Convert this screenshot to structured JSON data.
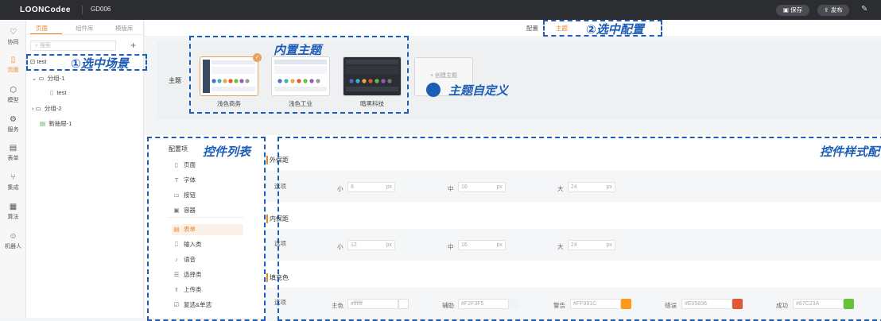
{
  "topbar": {
    "logo": "LOONCodee",
    "project": "GD006",
    "save_label": "保存",
    "publish_label": "发布",
    "save_icon": "save-icon",
    "publish_icon": "upload-icon"
  },
  "leftnav": {
    "items": [
      {
        "label": "协同",
        "glyph": "♡"
      },
      {
        "label": "页面",
        "glyph": "▯"
      },
      {
        "label": "模型",
        "glyph": "⬡"
      },
      {
        "label": "服务",
        "glyph": "⚙"
      },
      {
        "label": "表单",
        "glyph": "▤"
      },
      {
        "label": "集成",
        "glyph": "⑂"
      },
      {
        "label": "算法",
        "glyph": "▦"
      },
      {
        "label": "机器人",
        "glyph": "☺"
      }
    ]
  },
  "pagepane": {
    "tabs": [
      "页面",
      "组件库",
      "模版库"
    ],
    "search_placeholder": "搜索",
    "tree": [
      {
        "label": "test",
        "icon": "bookmark-icon"
      },
      {
        "label": "分组-1",
        "icon": "folder-icon"
      },
      {
        "label": "test",
        "icon": "page-icon"
      },
      {
        "label": "分组-2",
        "icon": "folder-icon"
      },
      {
        "label": "新抽屉-1",
        "icon": "drawer-icon"
      }
    ]
  },
  "config": {
    "tabs": [
      "配置",
      "主题"
    ],
    "active_tab": "主题"
  },
  "theme": {
    "label": "主题",
    "cards": [
      {
        "name": "浅色商务",
        "selected": true,
        "dark": false
      },
      {
        "name": "浅色工业",
        "selected": false,
        "dark": false
      },
      {
        "name": "暗黑科技",
        "selected": false,
        "dark": true
      }
    ],
    "create_label": "+ 创建主题"
  },
  "controls": {
    "header": "配置项",
    "items": [
      {
        "label": "页面",
        "glyph": "▯"
      },
      {
        "label": "字体",
        "glyph": "T"
      },
      {
        "label": "按钮",
        "glyph": "▭"
      },
      {
        "label": "容器",
        "glyph": "▣"
      },
      {
        "label": "表单",
        "glyph": "▤",
        "active": true
      },
      {
        "label": "输入类",
        "glyph": "⎕"
      },
      {
        "label": "语音",
        "glyph": "♪"
      },
      {
        "label": "选择类",
        "glyph": "☰"
      },
      {
        "label": "上传类",
        "glyph": "⇪"
      },
      {
        "label": "复选&单选",
        "glyph": "☑"
      }
    ]
  },
  "styles": {
    "sections": [
      {
        "title": "外保距",
        "row_label": "选项",
        "fields": [
          {
            "label": "小",
            "value": "8",
            "unit": "px"
          },
          {
            "label": "中",
            "value": "16",
            "unit": "px"
          },
          {
            "label": "大",
            "value": "24",
            "unit": "px"
          }
        ]
      },
      {
        "title": "内保距",
        "row_label": "选项",
        "fields": [
          {
            "label": "小",
            "value": "12",
            "unit": "px"
          },
          {
            "label": "中",
            "value": "16",
            "unit": "px"
          },
          {
            "label": "大",
            "value": "24",
            "unit": "px"
          }
        ]
      },
      {
        "title": "填充色",
        "row_label": "选项",
        "colors": [
          {
            "label": "主色",
            "value": "#ffffff",
            "swatch": "#ffffff"
          },
          {
            "label": "辅助",
            "value": "#F2F3F5",
            "swatch": "#F2F3F5"
          },
          {
            "label": "警告",
            "value": "#FF991C",
            "swatch": "#FF991C"
          },
          {
            "label": "错误",
            "value": "#E05836",
            "swatch": "#E05836"
          },
          {
            "label": "成功",
            "value": "#67C23A",
            "swatch": "#67C23A"
          }
        ]
      }
    ]
  },
  "annotations": {
    "select_scene": "①选中场景",
    "select_config": "②选中配置",
    "builtin_theme": "内置主题",
    "custom_theme": "主题自定义",
    "control_list": "控件列表",
    "control_style": "控件样式配"
  }
}
